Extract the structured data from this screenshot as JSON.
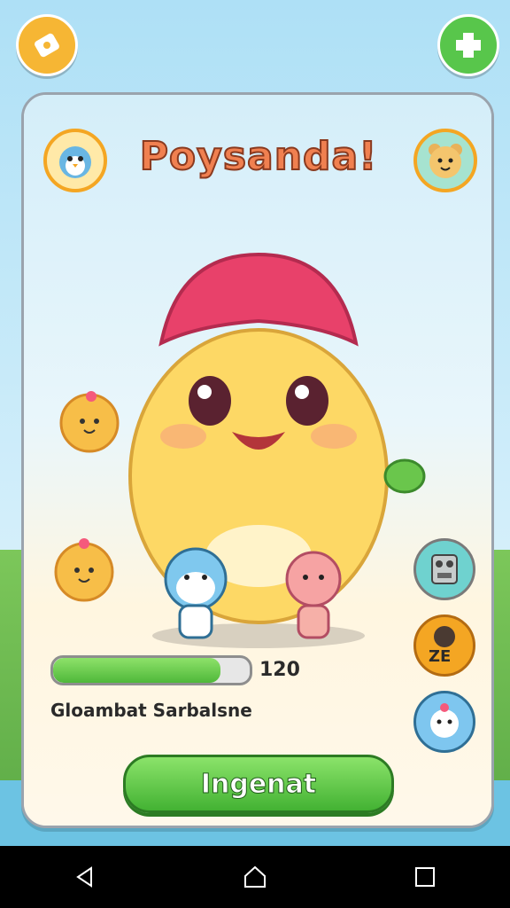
{
  "title": "Poysanda!",
  "progress": {
    "fraction": 0.85,
    "value_text": "120"
  },
  "status_text": "Gloambat Sarbalsne",
  "cta_label": "Ingenat",
  "badge_text": "ZE",
  "colors": {
    "accent_green": "#4fb83a",
    "title_orange": "#f08050",
    "avatar_ring": "#f4a623"
  }
}
